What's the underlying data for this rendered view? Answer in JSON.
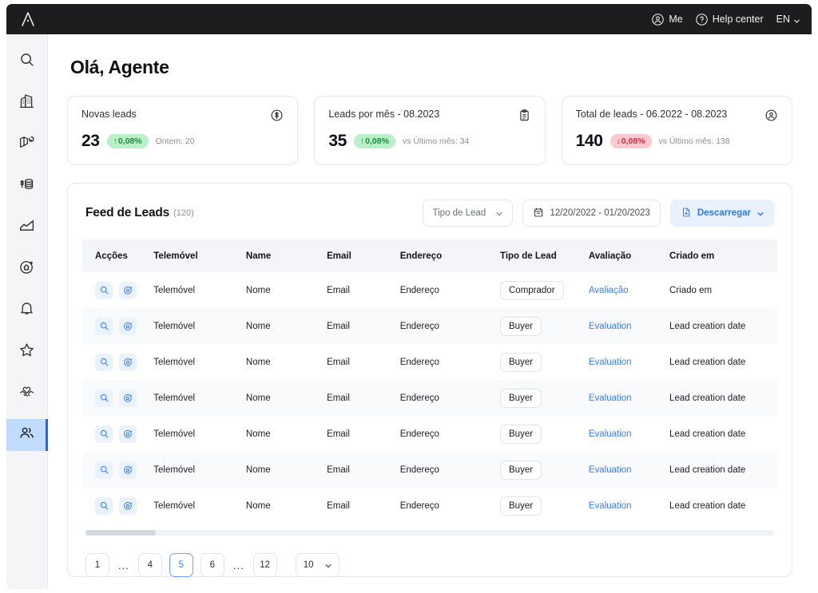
{
  "topbar": {
    "logo_alt": "A",
    "me_label": "Me",
    "help_label": "Help center",
    "language": "EN"
  },
  "sidebar": {
    "items": [
      {
        "icon": "search-icon",
        "name": "search",
        "active": false
      },
      {
        "icon": "building-icon",
        "name": "buildings",
        "active": false
      },
      {
        "icon": "map-icon",
        "name": "map",
        "active": false
      },
      {
        "icon": "money-stack-icon",
        "name": "finance",
        "active": false
      },
      {
        "icon": "chart-area-icon",
        "name": "analytics",
        "active": false
      },
      {
        "icon": "home-circle-icon",
        "name": "properties",
        "active": false
      },
      {
        "icon": "bell-icon",
        "name": "notifications",
        "active": false
      },
      {
        "icon": "star-icon",
        "name": "favorites",
        "active": false
      },
      {
        "icon": "handshake-heart-icon",
        "name": "deals",
        "active": false
      },
      {
        "icon": "people-icon",
        "name": "leads",
        "active": true
      }
    ]
  },
  "page": {
    "title": "Olá, Agente"
  },
  "stats": [
    {
      "label": "Novas leads",
      "value": "23",
      "badge": "0,08%",
      "badge_arrow": "↑",
      "direction": "up",
      "sub": "Ontem: 20",
      "icon": "dollar-circle-icon"
    },
    {
      "label": "Leads por mês - 08.2023",
      "value": "35",
      "badge": "0,08%",
      "badge_arrow": "↑",
      "direction": "up",
      "sub": "vs Último mês: 34",
      "icon": "clipboard-icon"
    },
    {
      "label": "Total de leads - 06.2022 - 08.2023",
      "value": "140",
      "badge": "0,08%",
      "badge_arrow": "↓",
      "direction": "down",
      "sub": "vs Último mês: 138",
      "icon": "user-circle-icon"
    }
  ],
  "feed": {
    "title": "Feed de Leads",
    "count": "(120)",
    "lead_type_filter": "Tipo de Lead",
    "date_range": "12/20/2022 - 01/20/2023",
    "download_label": "Descarregar",
    "columns": [
      "Acções",
      "Telemóvel",
      "Name",
      "Email",
      "Endereço",
      "Tipo de Lead",
      "Avaliação",
      "Criado em"
    ],
    "rows": [
      {
        "phone": "Telemóvel",
        "name": "Nome",
        "email": "Email",
        "address": "Endereço",
        "type": "Comprador",
        "evaluation": "Avaliação",
        "created": "Criado em"
      },
      {
        "phone": "Telemóvel",
        "name": "Nome",
        "email": "Email",
        "address": "Endereço",
        "type": "Buyer",
        "evaluation": "Evaluation",
        "created": "Lead creation date"
      },
      {
        "phone": "Telemóvel",
        "name": "Nome",
        "email": "Email",
        "address": "Endereço",
        "type": "Buyer",
        "evaluation": "Evaluation",
        "created": "Lead creation date"
      },
      {
        "phone": "Telemóvel",
        "name": "Nome",
        "email": "Email",
        "address": "Endereço",
        "type": "Buyer",
        "evaluation": "Evaluation",
        "created": "Lead creation date"
      },
      {
        "phone": "Telemóvel",
        "name": "Nome",
        "email": "Email",
        "address": "Endereço",
        "type": "Buyer",
        "evaluation": "Evaluation",
        "created": "Lead creation date"
      },
      {
        "phone": "Telemóvel",
        "name": "Nome",
        "email": "Email",
        "address": "Endereço",
        "type": "Buyer",
        "evaluation": "Evaluation",
        "created": "Lead creation date"
      },
      {
        "phone": "Telemóvel",
        "name": "Nome",
        "email": "Email",
        "address": "Endereço",
        "type": "Buyer",
        "evaluation": "Evaluation",
        "created": "Lead creation date"
      }
    ]
  },
  "pagination": {
    "pages": [
      "1",
      "...",
      "4",
      "5",
      "6",
      "...",
      "12"
    ],
    "current": "5",
    "page_size": "10"
  },
  "colors": {
    "accent_blue": "#3b82f6",
    "badge_up_bg": "#b9f0c8",
    "badge_up_fg": "#1a8a42",
    "badge_down_bg": "#ffc9cf",
    "badge_down_fg": "#d22d45",
    "topbar_bg": "#1d1d1f",
    "sidebar_bg": "#f5f5f7",
    "sidebar_active_bg": "#bfdbfe"
  }
}
